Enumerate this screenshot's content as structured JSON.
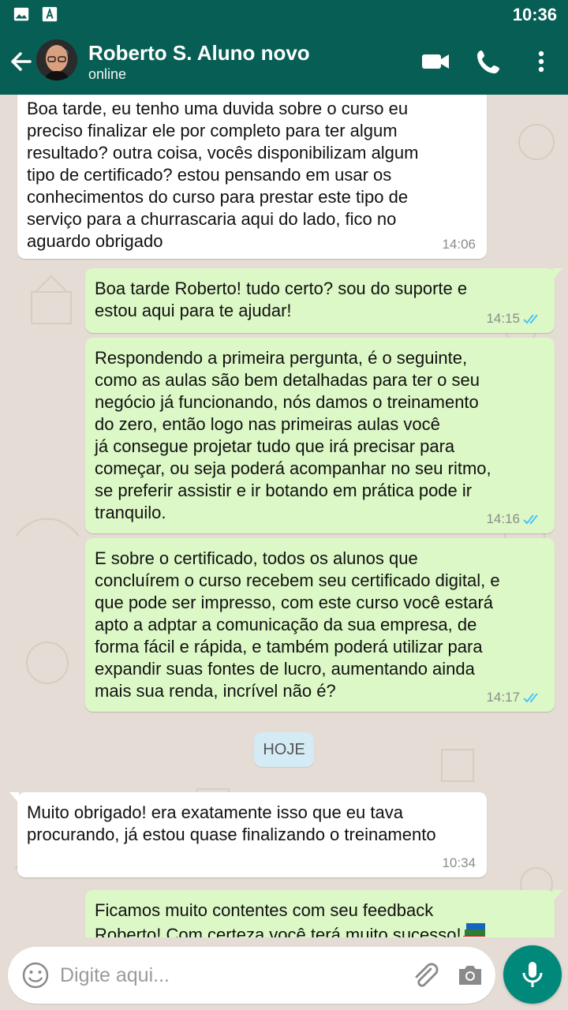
{
  "status_bar": {
    "time": "10:36",
    "left_icons": [
      "image-icon",
      "font-download-icon"
    ]
  },
  "header": {
    "contact_name": "Roberto S. Aluno novo",
    "presence": "online",
    "actions": [
      "video-call-icon",
      "phone-icon",
      "more-vert-icon"
    ]
  },
  "messages": [
    {
      "direction": "in",
      "text": "Boa tarde, eu tenho uma duvida sobre o curso eu\npreciso finalizar ele por completo para ter algum\nresultado? outra coisa, vocês disponibilizam algum\ntipo de certificado? estou pensando em usar os\nconhecimentos do curso para prestar este tipo de\nserviço para a churrascaria aqui do lado, fico no\naguardo obrigado",
      "time": "14:06"
    },
    {
      "direction": "out",
      "text": "Boa tarde Roberto! tudo certo? sou do suporte e\nestou aqui para te ajudar!",
      "time": "14:15",
      "status": "read"
    },
    {
      "direction": "out",
      "text": "Respondendo a primeira pergunta, é o seguinte,\ncomo as aulas são bem detalhadas para ter o seu\nnegócio já funcionando, nós damos o treinamento\ndo zero, então logo nas primeiras aulas você\njá consegue projetar tudo que irá precisar para\ncomeçar, ou seja poderá acompanhar no seu ritmo,\nse preferir assistir e ir botando em prática pode ir\ntranquilo.",
      "time": "14:16",
      "status": "read"
    },
    {
      "direction": "out",
      "text": "E sobre o certificado, todos os alunos que\nconcluírem o curso recebem seu certificado digital, e\nque pode ser impresso, com este curso você estará\napto a adptar a comunicação da sua empresa, de\nforma fácil e rápida, e também poderá utilizar para\nexpandir suas fontes de lucro, aumentando ainda\nmais sua renda, incrível não é?",
      "time": "14:17",
      "status": "read"
    },
    {
      "direction": "in",
      "text": "Muito obrigado! era exatamente isso que eu tava\nprocurando, já estou quase finalizando o treinamento",
      "time": "10:34"
    },
    {
      "direction": "out",
      "text": "Ficamos muito contentes com seu feedback\nRoberto! Com certeza você terá muito sucesso!",
      "emoji": "books-icon",
      "status": "read"
    }
  ],
  "day_divider": "HOJE",
  "composer": {
    "placeholder": "Digite aqui...",
    "value": ""
  },
  "colors": {
    "header": "#075e54",
    "outgoing_bubble": "#dcf8c6",
    "incoming_bubble": "#ffffff",
    "read_ticks": "#4fc3f7",
    "mic_button": "#00897b",
    "chat_background": "#e5ddd5"
  }
}
